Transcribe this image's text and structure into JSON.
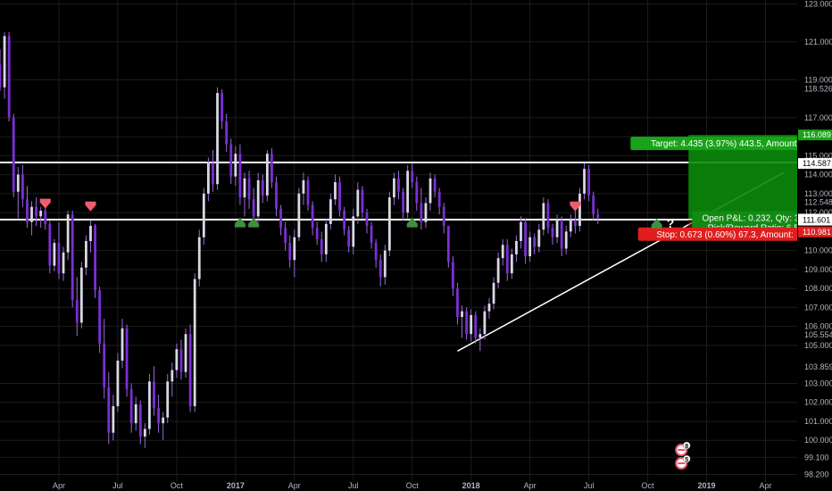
{
  "theme": {
    "background": "#000000",
    "grid": "#1c1c1c",
    "axis_text": "#b2b5be",
    "candle_up": "#d9d9e3",
    "candle_wick": "#9a6ad8",
    "candle_down": "#7b2fd6",
    "level_line": "#ffffff",
    "target_zone": "#0a8a0a",
    "target_label": "#19a319",
    "stop_label": "#e01e1e",
    "arrow_up": "#3f8f43",
    "arrow_down": "#f05d6c"
  },
  "chart_data": {
    "type": "candlestick",
    "y_axis": {
      "ylim": [
        97.8,
        123.2
      ],
      "ticks": [
        "123.000",
        "121.000",
        "119.000",
        "117.000",
        "116.000",
        "115.000",
        "114.000",
        "113.000",
        "112.000",
        "110.000",
        "109.000",
        "108.000",
        "107.000",
        "106.000",
        "105.000",
        "103.000",
        "102.000",
        "101.000",
        "100.000",
        "99.100",
        "98.200"
      ],
      "tick_values": [
        123,
        121,
        119,
        117,
        116,
        115,
        114,
        113,
        112,
        110,
        109,
        108,
        107,
        106,
        105,
        103,
        102,
        101,
        100,
        99.1,
        98.2
      ],
      "extra_labels": [
        {
          "text": "118.526",
          "value": 118.526
        },
        {
          "text": "112.548",
          "value": 112.548
        },
        {
          "text": "105.554",
          "value": 105.554
        },
        {
          "text": "103.859",
          "value": 103.859
        }
      ],
      "price_tags": [
        {
          "text": "116.089",
          "value": 116.089,
          "style": "target"
        },
        {
          "text": "114.587",
          "value": 114.587,
          "style": "white"
        },
        {
          "text": "111.654",
          "value": 111.654,
          "style": "white"
        },
        {
          "text": "111.601",
          "value": 111.601,
          "style": "white"
        },
        {
          "text": "110.981",
          "value": 110.981,
          "style": "stop"
        }
      ]
    },
    "x_axis": {
      "labels": [
        "Apr",
        "Jul",
        "Oct",
        "2017",
        "Apr",
        "Jul",
        "Oct",
        "2018",
        "Apr",
        "Jul",
        "Oct",
        "2019",
        "Apr"
      ],
      "label_index": [
        13,
        26,
        39,
        52,
        65,
        78,
        91,
        104,
        117,
        130,
        143,
        156,
        169
      ]
    },
    "index_range": [
      0,
      176
    ],
    "candles": [
      [
        119.8,
        120.6,
        118.4,
        118.6
      ],
      [
        118.6,
        121.5,
        118.0,
        121.3
      ],
      [
        121.3,
        121.5,
        116.8,
        117.0
      ],
      [
        117.0,
        117.2,
        112.8,
        113.1
      ],
      [
        113.1,
        114.4,
        111.7,
        114.0
      ],
      [
        114.0,
        114.5,
        112.3,
        112.7
      ],
      [
        112.7,
        113.4,
        111.2,
        111.5
      ],
      [
        111.5,
        112.6,
        110.8,
        112.3
      ],
      [
        112.3,
        112.8,
        111.3,
        111.8
      ],
      [
        111.8,
        112.3,
        111.2,
        112.1
      ],
      [
        112.1,
        112.4,
        111.1,
        111.4
      ],
      [
        111.4,
        111.6,
        108.8,
        109.2
      ],
      [
        109.2,
        110.6,
        108.9,
        110.4
      ],
      [
        110.4,
        111.5,
        108.5,
        108.8
      ],
      [
        108.8,
        110.2,
        108.4,
        109.9
      ],
      [
        109.9,
        112.1,
        109.5,
        111.9
      ],
      [
        111.9,
        112.1,
        107.0,
        107.4
      ],
      [
        107.4,
        108.6,
        105.5,
        106.2
      ],
      [
        106.2,
        109.4,
        105.9,
        109.1
      ],
      [
        109.1,
        110.8,
        108.7,
        110.5
      ],
      [
        110.5,
        111.6,
        109.9,
        111.3
      ],
      [
        111.3,
        111.4,
        107.5,
        107.9
      ],
      [
        107.9,
        108.1,
        104.6,
        105.1
      ],
      [
        105.1,
        106.4,
        102.2,
        102.8
      ],
      [
        102.8,
        103.6,
        99.8,
        100.4
      ],
      [
        100.4,
        102.4,
        100.0,
        101.8
      ],
      [
        101.8,
        104.6,
        101.5,
        104.2
      ],
      [
        104.2,
        106.4,
        103.8,
        105.9
      ],
      [
        105.9,
        106.1,
        102.3,
        102.7
      ],
      [
        102.7,
        103.0,
        100.4,
        100.9
      ],
      [
        100.9,
        102.3,
        100.5,
        101.9
      ],
      [
        101.9,
        102.1,
        99.8,
        100.2
      ],
      [
        100.2,
        100.9,
        99.6,
        100.6
      ],
      [
        100.6,
        103.5,
        100.3,
        103.1
      ],
      [
        103.1,
        103.9,
        101.3,
        101.7
      ],
      [
        101.7,
        102.4,
        100.4,
        100.9
      ],
      [
        100.9,
        101.5,
        100.0,
        101.2
      ],
      [
        101.2,
        103.5,
        100.9,
        103.1
      ],
      [
        103.1,
        104.1,
        102.3,
        103.7
      ],
      [
        103.7,
        105.1,
        103.3,
        104.8
      ],
      [
        104.8,
        105.3,
        103.2,
        103.6
      ],
      [
        103.6,
        105.9,
        103.3,
        105.6
      ],
      [
        105.6,
        106.1,
        101.5,
        101.8
      ],
      [
        101.8,
        108.8,
        101.5,
        108.5
      ],
      [
        108.5,
        111.1,
        108.1,
        110.7
      ],
      [
        110.7,
        113.3,
        110.3,
        113.0
      ],
      [
        113.0,
        114.9,
        112.6,
        114.6
      ],
      [
        114.6,
        115.3,
        113.1,
        113.5
      ],
      [
        113.5,
        118.6,
        113.2,
        118.3
      ],
      [
        118.3,
        118.5,
        116.4,
        116.8
      ],
      [
        116.8,
        117.2,
        115.2,
        115.6
      ],
      [
        115.6,
        115.9,
        113.5,
        113.9
      ],
      [
        113.9,
        115.5,
        113.4,
        115.1
      ],
      [
        115.1,
        115.6,
        112.4,
        112.8
      ],
      [
        112.8,
        114.1,
        111.8,
        113.8
      ],
      [
        113.8,
        114.2,
        112.2,
        112.7
      ],
      [
        112.7,
        113.3,
        111.4,
        111.8
      ],
      [
        111.8,
        114.1,
        111.5,
        113.7
      ],
      [
        113.7,
        114.0,
        112.5,
        112.9
      ],
      [
        112.9,
        115.3,
        112.6,
        115.1
      ],
      [
        115.1,
        115.4,
        113.3,
        113.6
      ],
      [
        113.6,
        113.9,
        111.8,
        112.2
      ],
      [
        112.2,
        112.4,
        110.8,
        111.2
      ],
      [
        111.2,
        111.5,
        110.0,
        110.4
      ],
      [
        110.4,
        110.8,
        109.1,
        109.5
      ],
      [
        109.5,
        111.1,
        108.6,
        110.7
      ],
      [
        110.7,
        113.3,
        110.5,
        113.0
      ],
      [
        113.0,
        114.1,
        112.4,
        113.7
      ],
      [
        113.7,
        113.9,
        112.1,
        112.4
      ],
      [
        112.4,
        112.6,
        110.8,
        111.2
      ],
      [
        111.2,
        111.5,
        110.3,
        110.6
      ],
      [
        110.6,
        111.0,
        109.4,
        109.8
      ],
      [
        109.8,
        111.7,
        109.4,
        111.4
      ],
      [
        111.4,
        113.0,
        111.1,
        112.7
      ],
      [
        112.7,
        114.0,
        112.4,
        113.6
      ],
      [
        113.6,
        113.9,
        111.8,
        112.1
      ],
      [
        112.1,
        112.3,
        110.8,
        111.1
      ],
      [
        111.1,
        111.3,
        109.9,
        110.2
      ],
      [
        110.2,
        112.2,
        109.8,
        111.8
      ],
      [
        111.8,
        113.6,
        111.4,
        113.2
      ],
      [
        113.2,
        113.4,
        111.7,
        112.0
      ],
      [
        112.0,
        112.2,
        110.9,
        111.3
      ],
      [
        111.3,
        111.5,
        110.1,
        110.4
      ],
      [
        110.4,
        110.6,
        109.1,
        109.5
      ],
      [
        109.5,
        109.8,
        108.1,
        108.6
      ],
      [
        108.6,
        110.3,
        108.2,
        110.0
      ],
      [
        110.0,
        113.1,
        109.7,
        112.8
      ],
      [
        112.8,
        114.1,
        112.4,
        113.8
      ],
      [
        113.8,
        114.2,
        112.7,
        113.1
      ],
      [
        113.1,
        113.3,
        111.6,
        112.0
      ],
      [
        112.0,
        114.5,
        111.7,
        114.2
      ],
      [
        114.2,
        114.6,
        113.3,
        113.6
      ],
      [
        113.6,
        113.9,
        112.1,
        112.5
      ],
      [
        112.5,
        113.3,
        111.1,
        111.5
      ],
      [
        111.5,
        112.8,
        111.2,
        112.5
      ],
      [
        112.5,
        114.1,
        112.1,
        113.8
      ],
      [
        113.8,
        114.0,
        112.8,
        113.1
      ],
      [
        113.1,
        113.3,
        111.9,
        112.3
      ],
      [
        112.3,
        112.5,
        110.9,
        111.3
      ],
      [
        111.3,
        110.6,
        109.1,
        109.4
      ],
      [
        109.4,
        109.7,
        107.6,
        108.0
      ],
      [
        108.0,
        108.3,
        106.1,
        106.5
      ],
      [
        106.5,
        107.1,
        105.4,
        106.8
      ],
      [
        106.8,
        107.0,
        105.3,
        105.6
      ],
      [
        105.6,
        106.9,
        105.2,
        106.6
      ],
      [
        106.6,
        106.8,
        105.1,
        105.4
      ],
      [
        105.4,
        105.9,
        104.7,
        105.6
      ],
      [
        105.6,
        107.1,
        105.3,
        106.8
      ],
      [
        106.8,
        107.5,
        106.4,
        107.2
      ],
      [
        107.2,
        108.6,
        106.9,
        108.3
      ],
      [
        108.3,
        109.9,
        108.0,
        109.6
      ],
      [
        109.6,
        110.6,
        109.2,
        110.3
      ],
      [
        110.3,
        110.6,
        108.4,
        108.8
      ],
      [
        108.8,
        110.1,
        108.5,
        109.8
      ],
      [
        109.8,
        110.8,
        109.4,
        110.5
      ],
      [
        110.5,
        111.8,
        110.1,
        111.5
      ],
      [
        111.5,
        111.7,
        109.3,
        109.7
      ],
      [
        109.7,
        111.0,
        109.4,
        110.7
      ],
      [
        110.7,
        110.9,
        109.8,
        110.2
      ],
      [
        110.2,
        111.4,
        109.9,
        111.1
      ],
      [
        111.1,
        112.8,
        110.8,
        112.5
      ],
      [
        112.5,
        112.7,
        110.9,
        111.2
      ],
      [
        111.2,
        111.4,
        110.3,
        110.7
      ],
      [
        110.7,
        111.9,
        110.4,
        111.6
      ],
      [
        111.6,
        111.8,
        109.7,
        110.1
      ],
      [
        110.1,
        111.3,
        109.8,
        111.0
      ],
      [
        111.0,
        111.9,
        110.7,
        111.6
      ],
      [
        111.6,
        112.4,
        110.9,
        111.3
      ],
      [
        111.3,
        113.3,
        111.0,
        113.0
      ],
      [
        113.0,
        114.6,
        112.7,
        114.3
      ],
      [
        114.3,
        114.5,
        112.6,
        112.9
      ],
      [
        112.9,
        113.1,
        111.6,
        111.9
      ],
      [
        111.9,
        112.2,
        111.4,
        111.7
      ]
    ],
    "horizontal_levels": [
      114.64,
      111.63
    ],
    "trendline": {
      "x1_index": 101,
      "y1": 104.7,
      "x2_index": 173,
      "y2": 114.1
    },
    "arrows": [
      {
        "type": "down",
        "index": 10,
        "value": 112.4
      },
      {
        "type": "down",
        "index": 20,
        "value": 112.25
      },
      {
        "type": "up",
        "index": 53,
        "value": 111.55
      },
      {
        "type": "up",
        "index": 56,
        "value": 111.55
      },
      {
        "type": "up",
        "index": 91,
        "value": 111.55
      },
      {
        "type": "down",
        "index": 127,
        "value": 112.25
      },
      {
        "type": "up",
        "index": 145,
        "value": 111.5
      }
    ],
    "position": {
      "entry_index_start": 145,
      "entry_index_end": 152,
      "target_value": 116.089,
      "entry_value": 111.654,
      "stop_value": 110.981,
      "target_text": "Target: 4.435 (3.97%) 443.5, Amount:",
      "pnl_text": "Open P&L: 0.232, Qty: 371",
      "rr_text": "Risk/Reward Ratio: 6.59",
      "stop_text": "Stop: 0.673 (0.60%) 67.3, Amount:"
    },
    "question_mark": "?",
    "event_markers": [
      {
        "label": "8"
      },
      {
        "label": "5"
      }
    ]
  }
}
